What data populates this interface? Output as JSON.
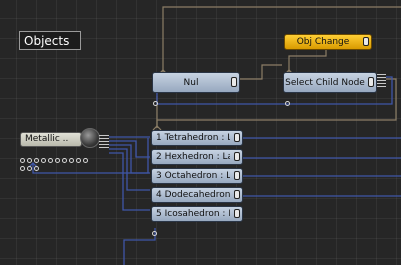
{
  "comment_label": "Objects",
  "nodes": {
    "obj_change": "Obj Change",
    "null": "Nul",
    "select_child": "Select  Child  Node",
    "metallic": "Metallic  ...",
    "shapes": [
      "1  Tetrahedron  :  L...",
      "2  Hexhedron  :  La...",
      "3  Octahedron  :  La...",
      "4  Dodecahedron  :  ...",
      "5  Icosahedron  :  L..."
    ]
  },
  "colors": {
    "node_blue": "#a9b9cf",
    "node_gold": "#f2b710",
    "wire_blue": "#3f56a8",
    "wire_tan": "#8c7e66",
    "background": "#262626"
  },
  "icons": {
    "material_preview": "sphere-icon",
    "output_handle": "bars-icon",
    "port": "circle-port-icon"
  }
}
